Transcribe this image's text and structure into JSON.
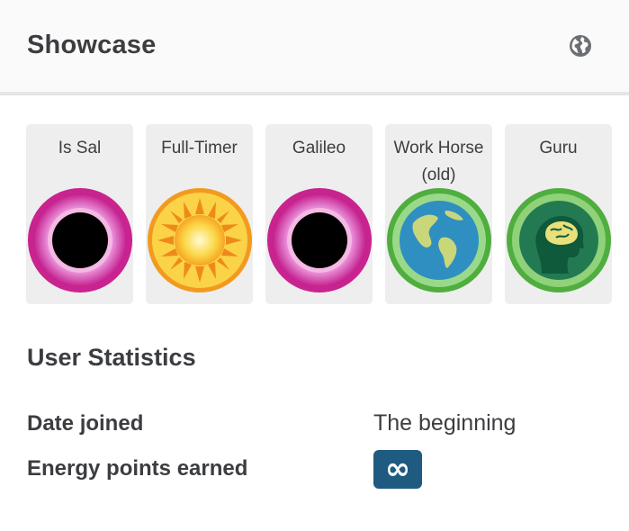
{
  "header": {
    "title": "Showcase",
    "globe_icon": "globe-icon"
  },
  "badges": [
    {
      "label": "Is Sal",
      "icon": "black-hole-badge-icon"
    },
    {
      "label": "Full-Timer",
      "icon": "sun-badge-icon"
    },
    {
      "label": "Galileo",
      "icon": "black-hole-badge-icon"
    },
    {
      "label": "Work Horse\n(old)",
      "icon": "earth-badge-icon"
    },
    {
      "label": "Guru",
      "icon": "brain-badge-icon"
    }
  ],
  "stats": {
    "title": "User Statistics",
    "date_joined_label": "Date joined",
    "date_joined_value": "The beginning",
    "energy_points_label": "Energy points earned",
    "energy_points_value": "∞"
  },
  "colors": {
    "header_bg": "#fafafa",
    "badge_bg": "#eeeeee",
    "text": "#3b3d40",
    "infinity_bg": "#1f5a80",
    "pink": "#d2369f",
    "green": "#5fbe56"
  }
}
